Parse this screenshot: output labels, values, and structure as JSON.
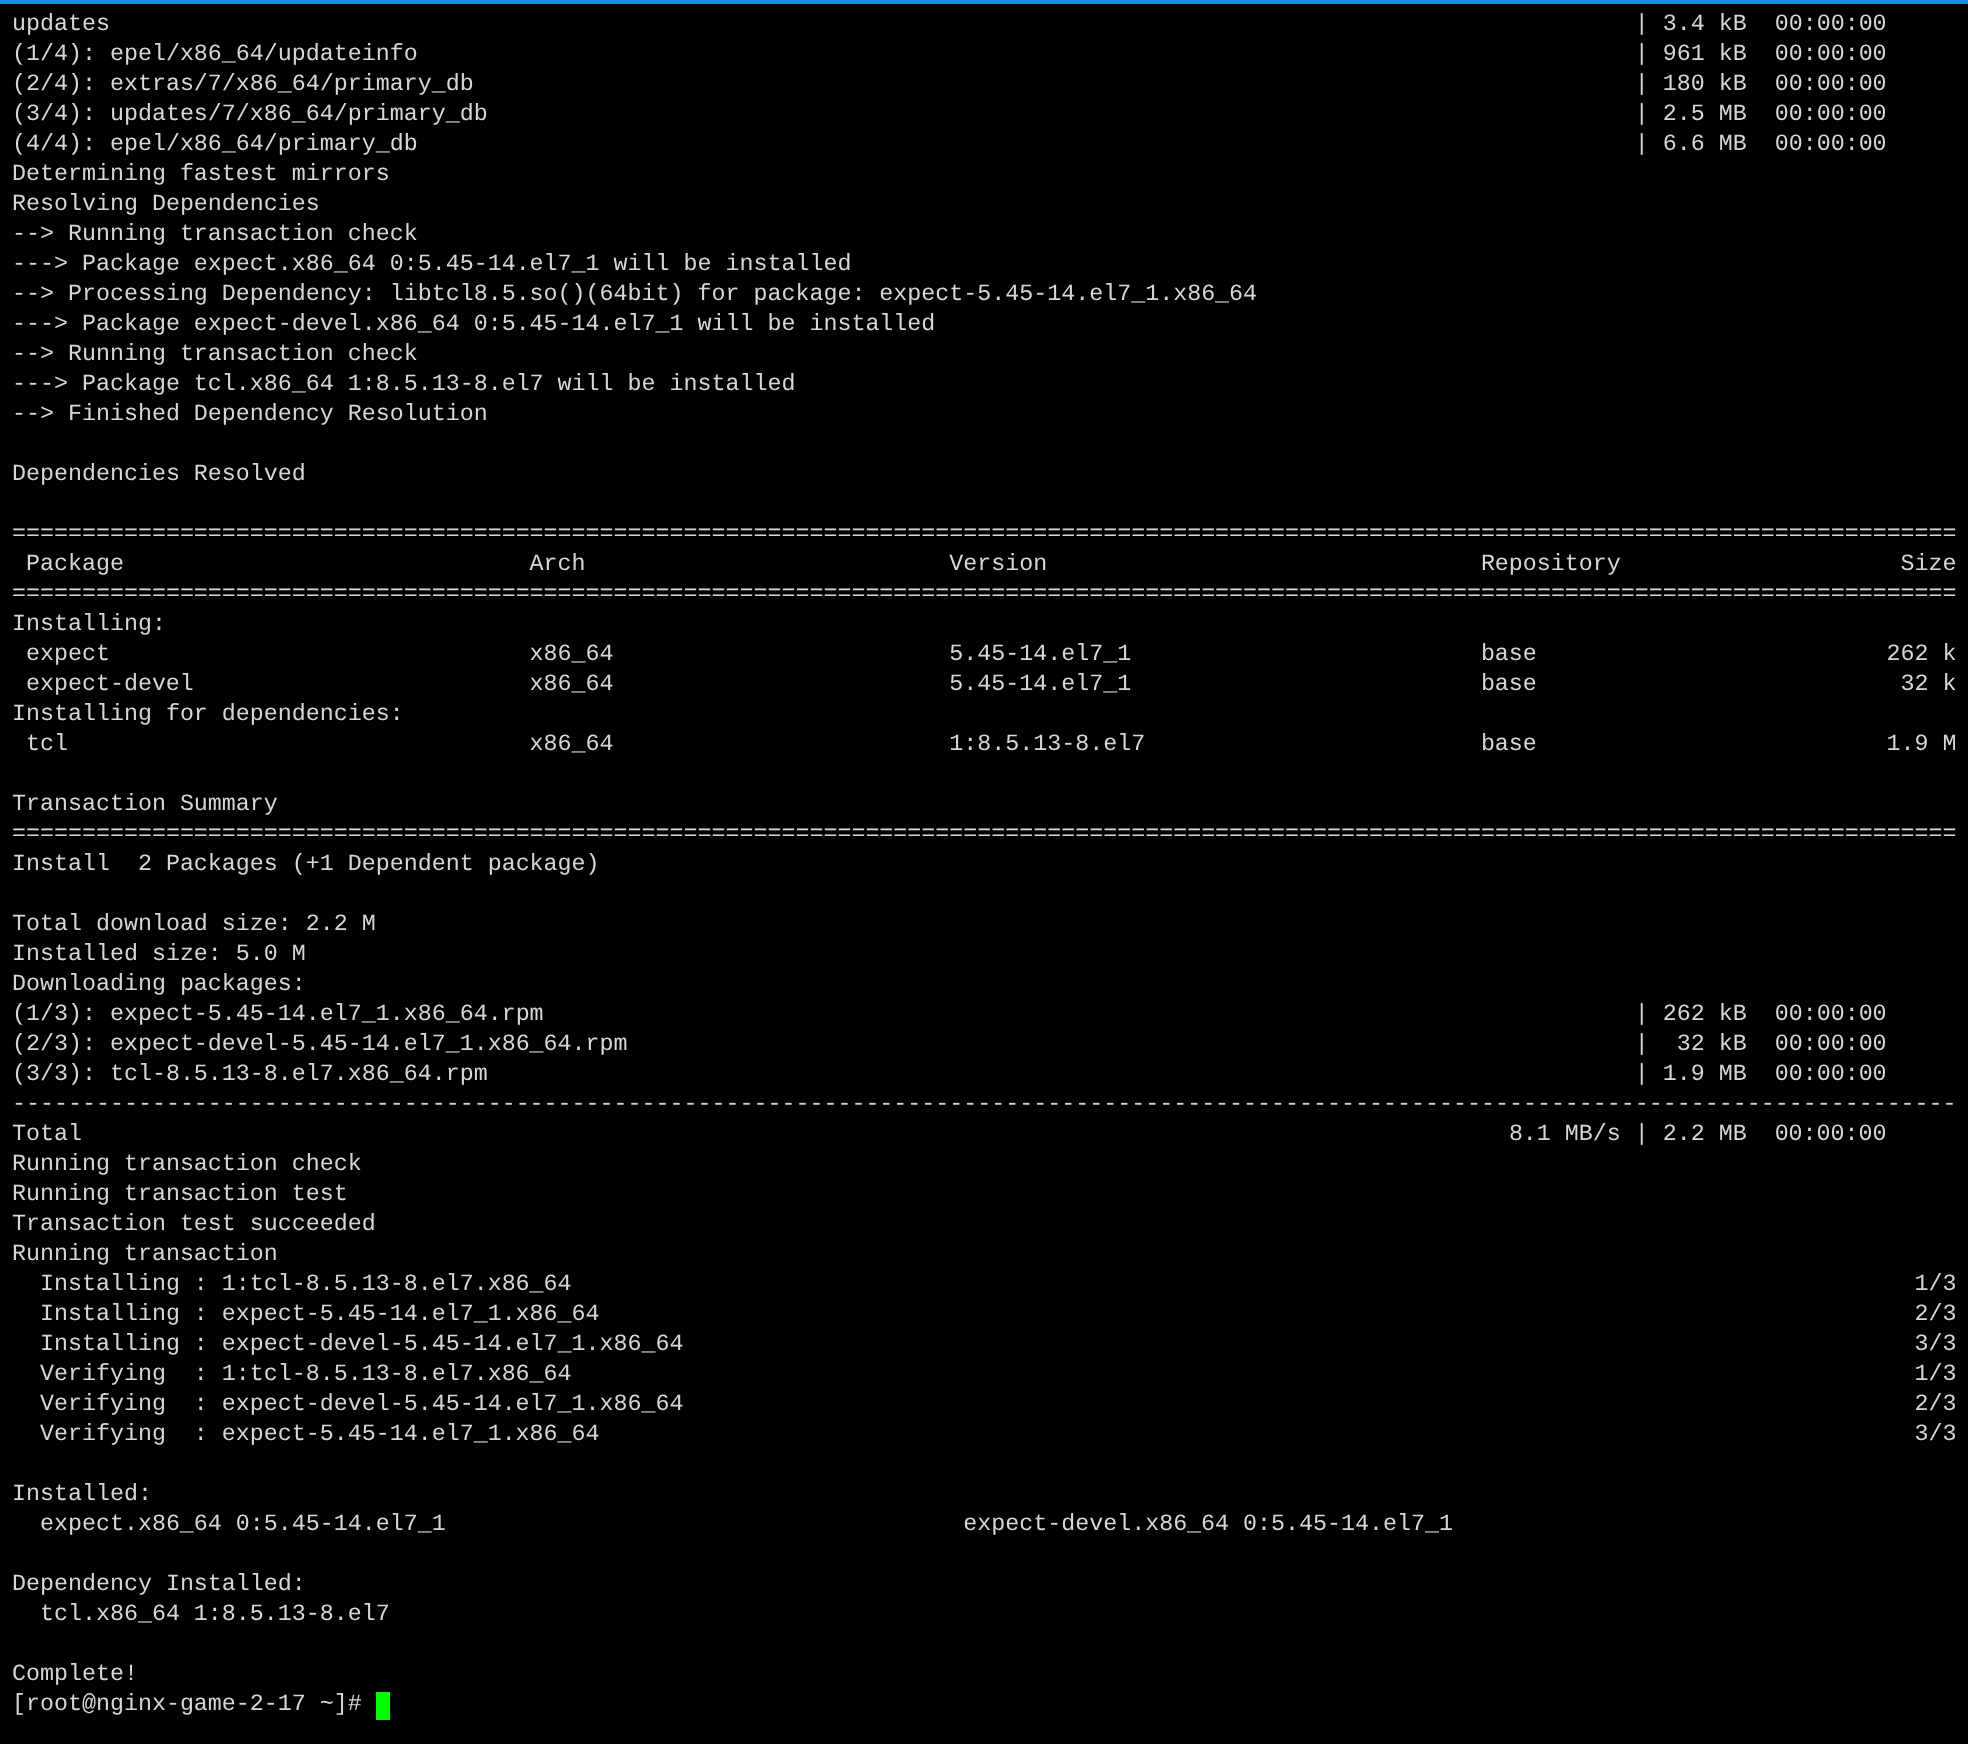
{
  "terminal": {
    "lines": [
      {
        "kind": "download",
        "name": "updates",
        "size": "| 3.4 kB",
        "time": "00:00:00"
      },
      {
        "kind": "download",
        "name": "(1/4): epel/x86_64/updateinfo",
        "size": "| 961 kB",
        "time": "00:00:00"
      },
      {
        "kind": "download",
        "name": "(2/4): extras/7/x86_64/primary_db",
        "size": "| 180 kB",
        "time": "00:00:00"
      },
      {
        "kind": "download",
        "name": "(3/4): updates/7/x86_64/primary_db",
        "size": "| 2.5 MB",
        "time": "00:00:00"
      },
      {
        "kind": "download",
        "name": "(4/4): epel/x86_64/primary_db",
        "size": "| 6.6 MB",
        "time": "00:00:00"
      },
      {
        "kind": "text",
        "text": "Determining fastest mirrors"
      },
      {
        "kind": "text",
        "text": "Resolving Dependencies"
      },
      {
        "kind": "text",
        "text": "--> Running transaction check"
      },
      {
        "kind": "text",
        "text": "---> Package expect.x86_64 0:5.45-14.el7_1 will be installed"
      },
      {
        "kind": "text",
        "text": "--> Processing Dependency: libtcl8.5.so()(64bit) for package: expect-5.45-14.el7_1.x86_64"
      },
      {
        "kind": "text",
        "text": "---> Package expect-devel.x86_64 0:5.45-14.el7_1 will be installed"
      },
      {
        "kind": "text",
        "text": "--> Running transaction check"
      },
      {
        "kind": "text",
        "text": "---> Package tcl.x86_64 1:8.5.13-8.el7 will be installed"
      },
      {
        "kind": "text",
        "text": "--> Finished Dependency Resolution"
      },
      {
        "kind": "blank"
      },
      {
        "kind": "text",
        "text": "Dependencies Resolved"
      },
      {
        "kind": "blank"
      },
      {
        "kind": "rule",
        "text": "==========================================================================================================================================="
      },
      {
        "kind": "header",
        "cells": [
          "Package",
          "Arch",
          "Version",
          "Repository",
          "Size"
        ]
      },
      {
        "kind": "rule",
        "text": "==========================================================================================================================================="
      },
      {
        "kind": "text",
        "text": "Installing:"
      },
      {
        "kind": "row",
        "cells": [
          "expect",
          "x86_64",
          "5.45-14.el7_1",
          "base",
          "262 k"
        ]
      },
      {
        "kind": "row",
        "cells": [
          "expect-devel",
          "x86_64",
          "5.45-14.el7_1",
          "base",
          "32 k"
        ]
      },
      {
        "kind": "text",
        "text": "Installing for dependencies:"
      },
      {
        "kind": "row",
        "cells": [
          "tcl",
          "x86_64",
          "1:8.5.13-8.el7",
          "base",
          "1.9 M"
        ]
      },
      {
        "kind": "blank"
      },
      {
        "kind": "text",
        "text": "Transaction Summary"
      },
      {
        "kind": "rule",
        "text": "==========================================================================================================================================="
      },
      {
        "kind": "text",
        "text": "Install  2 Packages (+1 Dependent package)"
      },
      {
        "kind": "blank"
      },
      {
        "kind": "text",
        "text": "Total download size: 2.2 M"
      },
      {
        "kind": "text",
        "text": "Installed size: 5.0 M"
      },
      {
        "kind": "text",
        "text": "Downloading packages:"
      },
      {
        "kind": "download",
        "name": "(1/3): expect-5.45-14.el7_1.x86_64.rpm",
        "size": "| 262 kB",
        "time": "00:00:00"
      },
      {
        "kind": "download",
        "name": "(2/3): expect-devel-5.45-14.el7_1.x86_64.rpm",
        "size": "|  32 kB",
        "time": "00:00:00"
      },
      {
        "kind": "download",
        "name": "(3/3): tcl-8.5.13-8.el7.x86_64.rpm",
        "size": "| 1.9 MB",
        "time": "00:00:00"
      },
      {
        "kind": "rule",
        "text": "-------------------------------------------------------------------------------------------------------------------------------------------"
      },
      {
        "kind": "total",
        "name": "Total",
        "rate": "8.1 MB/s",
        "size": "| 2.2 MB",
        "time": "00:00:00"
      },
      {
        "kind": "text",
        "text": "Running transaction check"
      },
      {
        "kind": "text",
        "text": "Running transaction test"
      },
      {
        "kind": "text",
        "text": "Transaction test succeeded"
      },
      {
        "kind": "text",
        "text": "Running transaction"
      },
      {
        "kind": "step",
        "text": "Installing : 1:tcl-8.5.13-8.el7.x86_64",
        "count": "1/3"
      },
      {
        "kind": "step",
        "text": "Installing : expect-5.45-14.el7_1.x86_64",
        "count": "2/3"
      },
      {
        "kind": "step",
        "text": "Installing : expect-devel-5.45-14.el7_1.x86_64",
        "count": "3/3"
      },
      {
        "kind": "step",
        "text": "Verifying  : 1:tcl-8.5.13-8.el7.x86_64",
        "count": "1/3"
      },
      {
        "kind": "step",
        "text": "Verifying  : expect-devel-5.45-14.el7_1.x86_64",
        "count": "2/3"
      },
      {
        "kind": "step",
        "text": "Verifying  : expect-5.45-14.el7_1.x86_64",
        "count": "3/3"
      },
      {
        "kind": "blank"
      },
      {
        "kind": "text",
        "text": "Installed:"
      },
      {
        "kind": "packages",
        "items": [
          "expect.x86_64 0:5.45-14.el7_1",
          "expect-devel.x86_64 0:5.45-14.el7_1"
        ]
      },
      {
        "kind": "blank"
      },
      {
        "kind": "text",
        "text": "Dependency Installed:"
      },
      {
        "kind": "packages",
        "items": [
          "tcl.x86_64 1:8.5.13-8.el7"
        ]
      },
      {
        "kind": "blank"
      },
      {
        "kind": "text",
        "text": "Complete!"
      },
      {
        "kind": "prompt",
        "text": "[root@nginx-game-2-17 ~]#",
        "cursor": true
      }
    ]
  }
}
